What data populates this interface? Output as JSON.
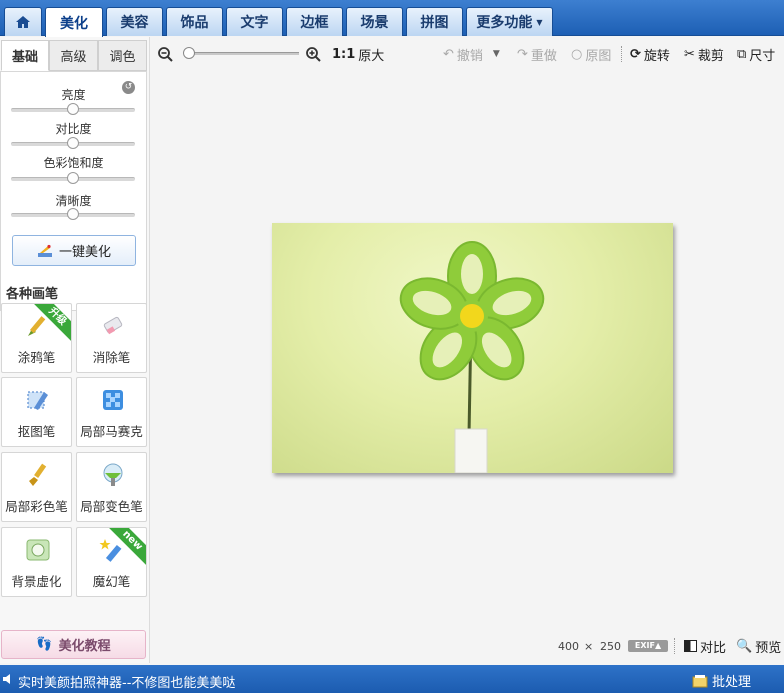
{
  "tabs": [
    {
      "label": "",
      "icon": "home-icon"
    },
    {
      "label": "美化"
    },
    {
      "label": "美容"
    },
    {
      "label": "饰品"
    },
    {
      "label": "文字"
    },
    {
      "label": "边框"
    },
    {
      "label": "场景"
    },
    {
      "label": "拼图"
    },
    {
      "label": "更多功能"
    }
  ],
  "active_tab": "美化",
  "subtabs": [
    "基础",
    "高级",
    "调色"
  ],
  "active_subtab": "基础",
  "sliders": [
    {
      "label": "亮度",
      "value": 0.5
    },
    {
      "label": "对比度",
      "value": 0.5
    },
    {
      "label": "色彩饱和度",
      "value": 0.5
    },
    {
      "label": "清晰度",
      "value": 0.5
    }
  ],
  "auto_beautify_label": "一键美化",
  "brushes_title": "各种画笔",
  "brushes": [
    {
      "label": "涂鸦笔",
      "badge": "升级",
      "icon": "graffiti-brush-icon"
    },
    {
      "label": "消除笔",
      "badge": "",
      "icon": "eraser-icon"
    },
    {
      "label": "抠图笔",
      "badge": "",
      "icon": "cutout-pen-icon"
    },
    {
      "label": "局部马赛克",
      "badge": "",
      "icon": "mosaic-icon"
    },
    {
      "label": "局部彩色笔",
      "badge": "",
      "icon": "color-brush-icon"
    },
    {
      "label": "局部变色笔",
      "badge": "",
      "icon": "recolor-brush-icon"
    },
    {
      "label": "背景虚化",
      "badge": "",
      "icon": "background-blur-icon"
    },
    {
      "label": "魔幻笔",
      "badge": "new",
      "icon": "magic-wand-icon"
    }
  ],
  "tutorial_label": "美化教程",
  "toolbar": {
    "zoom_value": 0.0,
    "actual_size_prefix": "1:1",
    "actual_size_label": "原大",
    "undo_label": "撤销",
    "redo_label": "重做",
    "original_label": "原图",
    "rotate_label": "旋转",
    "crop_label": "裁剪",
    "size_label": "尺寸"
  },
  "image": {
    "width": "400",
    "times": "×",
    "height": "250"
  },
  "exif_label": "EXIF▲",
  "compare_label": "对比",
  "preview_label": "预览",
  "status_text": "实时美颜拍照神器--不修图也能美美哒",
  "batch_label": "批处理",
  "colors": {
    "tab_bar": "#2a6cc4",
    "status_bar": "#2468bf",
    "photo_bg": "#e4eea9",
    "flower": "#8fcc3a",
    "flower_center": "#f2d71c",
    "ribbon_green": "#3aa83a"
  }
}
